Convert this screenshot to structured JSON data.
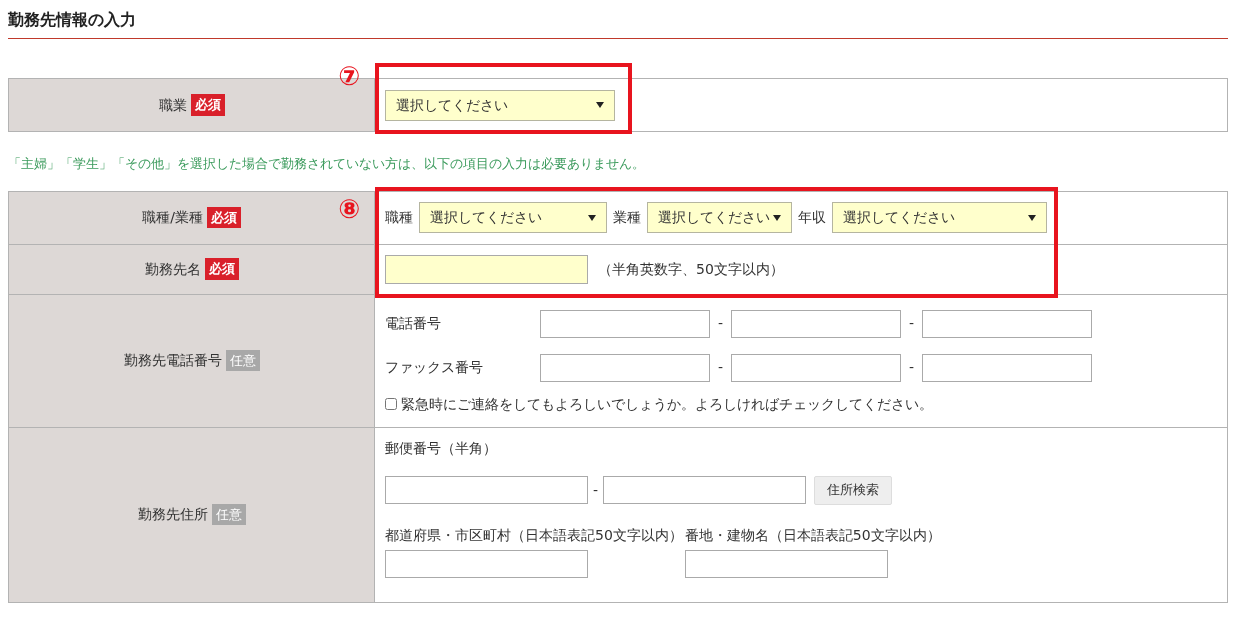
{
  "heading": "勤務先情報の入力",
  "annotations": [
    {
      "label": "⑦"
    },
    {
      "label": "⑧"
    }
  ],
  "tables": [
    {
      "rows": [
        {
          "kind": "selects",
          "label": "職業",
          "badge": "必須",
          "required": true,
          "selects": [
            {
              "value": "選択してください"
            }
          ]
        }
      ]
    },
    {
      "rows": [
        {
          "kind": "selects",
          "label": "職種/業種",
          "badge": "必須",
          "required": true,
          "selects": [
            {
              "label": "職種",
              "value": "選択してください"
            },
            {
              "label": "業種",
              "value": "選択してください"
            },
            {
              "label": "年収",
              "value": "選択してください"
            }
          ]
        },
        {
          "kind": "text",
          "label": "勤務先名",
          "badge": "必須",
          "required": true,
          "hint": "（半角英数字、50文字以内）"
        },
        {
          "kind": "phone",
          "label": "勤務先電話番号",
          "badge": "任意",
          "required": false,
          "lines": [
            {
              "label": "電話番号",
              "separators": [
                "-",
                "-"
              ]
            },
            {
              "label": "ファックス番号",
              "separators": [
                "-",
                "-"
              ]
            }
          ],
          "checkbox": {
            "label": "緊急時にご連絡をしてもよろしいでしょうか。よろしければチェックしてください。",
            "checked": false
          }
        },
        {
          "kind": "address",
          "label": "勤務先住所",
          "badge": "任意",
          "required": false,
          "postal_label": "郵便番号（半角）",
          "postal_separator": "-",
          "search_button": "住所検索",
          "fields": [
            {
              "label": "都道府県・市区町村（日本語表記50文字以内）"
            },
            {
              "label": "番地・建物名（日本語表記50文字以内）"
            }
          ]
        }
      ]
    }
  ],
  "note": "「主婦」「学生」「その他」を選択した場合で勤務されていない方は、以下の項目の入力は必要ありません。"
}
